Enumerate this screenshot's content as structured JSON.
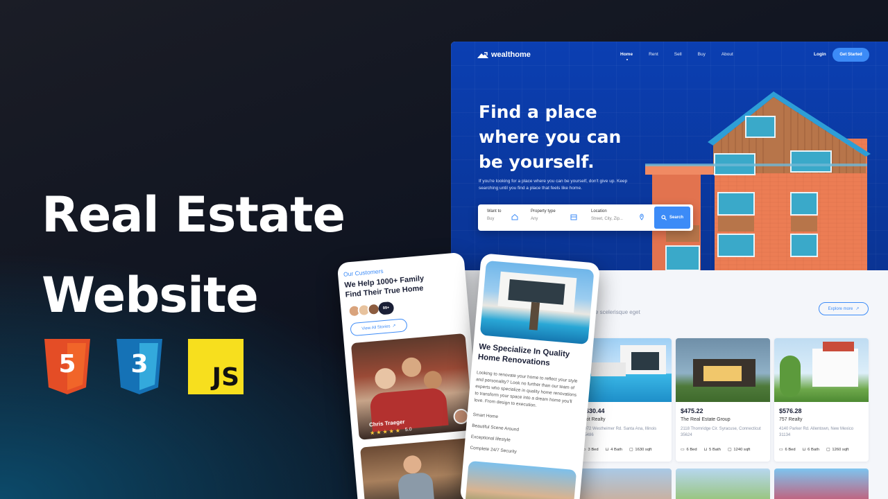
{
  "headline": {
    "line1": "Real Estate",
    "line2": "Website"
  },
  "tech_icons": [
    "html5-icon",
    "css3-icon",
    "javascript-icon"
  ],
  "tech": {
    "html_num": "5",
    "css_num": "3",
    "js_label": "JS"
  },
  "colors": {
    "brand_blue": "#0b3fb2",
    "accent": "#3c8bf7",
    "html": "#e44d26",
    "css": "#2965f1",
    "js": "#f7df1e"
  },
  "site": {
    "logo": "wealthome",
    "nav": [
      "Home",
      "Rent",
      "Sell",
      "Buy",
      "About"
    ],
    "login": "Login",
    "get_started": "Get Started",
    "hero": {
      "line1": "Find a place",
      "line2": "where you can",
      "line3": "be yourself.",
      "sub": "If you're looking for a place where you can be yourself, don't give up. Keep searching until you find a place that feels like home."
    },
    "search": {
      "want_label": "Want to",
      "want_value": "Buy",
      "type_label": "Property type",
      "type_value": "Any",
      "loc_label": "Location",
      "loc_placeholder": "Street, City, Zip...",
      "button": "Search"
    },
    "section": {
      "title": "y",
      "sub": "sque scelerisque eget",
      "explore": "Explore more"
    },
    "listings": [
      {
        "price": "$630.44",
        "agency": "Exit Realty",
        "addr": "2972 Westheimer Rd. Santa Ana, Illinois 85486",
        "bed": "3 Bed",
        "bath": "4 Bath",
        "sqft": "1630 sqft"
      },
      {
        "price": "$475.22",
        "agency": "The Real Estate Group",
        "addr": "2118 Thornridge Cir. Syracuse, Connecticut 35624",
        "bed": "6 Bed",
        "bath": "5 Bath",
        "sqft": "1240 sqft"
      },
      {
        "price": "$576.28",
        "agency": "757 Realty",
        "addr": "4140 Parker Rd. Allentown, New Mexico 31134",
        "bed": "6 Bed",
        "bath": "6 Bath",
        "sqft": "1260 sqft"
      }
    ]
  },
  "phone1": {
    "kicker": "Our Customers",
    "title_l1": "We Help 1000+ Family",
    "title_l2": "Find Their True Home",
    "count": "99+",
    "view_all": "View All Stories",
    "reviewer": "Chris Traeger",
    "rating": "5.0",
    "rating_value": 5
  },
  "phone2": {
    "title_l1": "We Specialize In Quality",
    "title_l2": "Home Renovations",
    "desc": "Looking to renovate your home to reflect your style and personality? Look no further than our team of experts who specialize in quality home renovations to transform your space into a dream home you'll love. From design to execution.",
    "items": [
      "Smart Home",
      "Beautiful Scene Around",
      "Exceptional lifestyle",
      "Complete 24/7 Security"
    ]
  }
}
